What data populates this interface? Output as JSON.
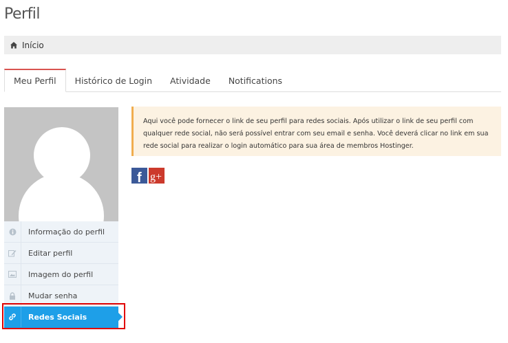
{
  "page": {
    "title": "Perfil"
  },
  "breadcrumb": {
    "home_label": "Início"
  },
  "tabs": [
    {
      "label": "Meu Perfil",
      "active": true
    },
    {
      "label": "Histórico de Login",
      "active": false
    },
    {
      "label": "Atividade",
      "active": false
    },
    {
      "label": "Notifications",
      "active": false
    }
  ],
  "sidebar": {
    "items": [
      {
        "label": "Informação do perfil",
        "icon": "info-icon"
      },
      {
        "label": "Editar perfil",
        "icon": "edit-icon"
      },
      {
        "label": "Imagem do perfil",
        "icon": "image-icon"
      },
      {
        "label": "Mudar senha",
        "icon": "lock-icon"
      },
      {
        "label": "Redes Sociais",
        "icon": "link-icon",
        "active": true
      }
    ]
  },
  "alert": {
    "text": "Aqui você pode fornecer o link de seu perfil para redes sociais. Após utilizar o link de seu perfil com qualquer rede social, não será possível entrar com seu email e senha. Você deverá clicar no link em sua rede social para realizar o login automático para sua área de membros Hostinger."
  },
  "social": {
    "facebook_glyph": "f",
    "google_glyph": "g+"
  },
  "colors": {
    "accent_blue": "#1e9fe8",
    "tab_active_border": "#d9534f",
    "alert_border": "#f0ad4e",
    "alert_bg": "#fcf2e2",
    "highlight": "#e00000",
    "facebook": "#3b5998",
    "google_plus": "#cc3a2c"
  }
}
